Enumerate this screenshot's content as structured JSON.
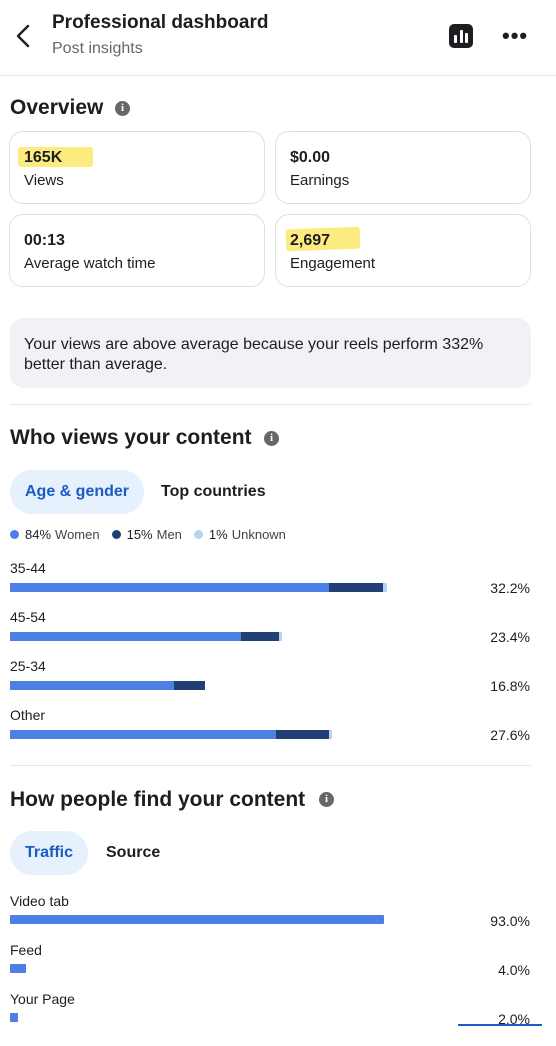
{
  "header": {
    "title": "Professional dashboard",
    "subtitle": "Post insights"
  },
  "overview": {
    "title": "Overview",
    "cards": [
      {
        "value": "165K",
        "label": "Views",
        "highlighted": true
      },
      {
        "value": "$0.00",
        "label": "Earnings",
        "highlighted": false
      },
      {
        "value": "00:13",
        "label": "Average watch time",
        "highlighted": false
      },
      {
        "value": "2,697",
        "label": "Engagement",
        "highlighted": true
      }
    ],
    "note": "Your views are above average because your reels perform 332% better than average."
  },
  "who_views": {
    "title": "Who views your content",
    "tabs": [
      "Age & gender",
      "Top countries"
    ],
    "legend": [
      {
        "pct": "84%",
        "label": "Women",
        "color": "#4c80e4"
      },
      {
        "pct": "15%",
        "label": "Men",
        "color": "#213f74"
      },
      {
        "pct": "1%",
        "label": "Unknown",
        "color": "#b6d3f5"
      }
    ],
    "rows": [
      {
        "label": "35-44",
        "pct": "32.2%",
        "women": 0.855,
        "men": 0.145,
        "unknown": 0.01
      },
      {
        "label": "45-54",
        "pct": "23.4%",
        "women": 0.85,
        "men": 0.14,
        "unknown": 0.01
      },
      {
        "label": "25-34",
        "pct": "16.8%",
        "women": 0.84,
        "men": 0.16,
        "unknown": 0.0
      },
      {
        "label": "Other",
        "pct": "27.6%",
        "women": 0.83,
        "men": 0.165,
        "unknown": 0.01
      }
    ]
  },
  "how_find": {
    "title": "How people find your content",
    "tabs": [
      "Traffic",
      "Source"
    ],
    "rows": [
      {
        "label": "Video tab",
        "pct": "93.0%",
        "value": 93.0
      },
      {
        "label": "Feed",
        "pct": "4.0%",
        "value": 4.0
      },
      {
        "label": "Your Page",
        "pct": "2.0%",
        "value": 2.0
      }
    ]
  },
  "colors": {
    "accent": "#1a5cc4",
    "highlight": "#fbe96a"
  }
}
